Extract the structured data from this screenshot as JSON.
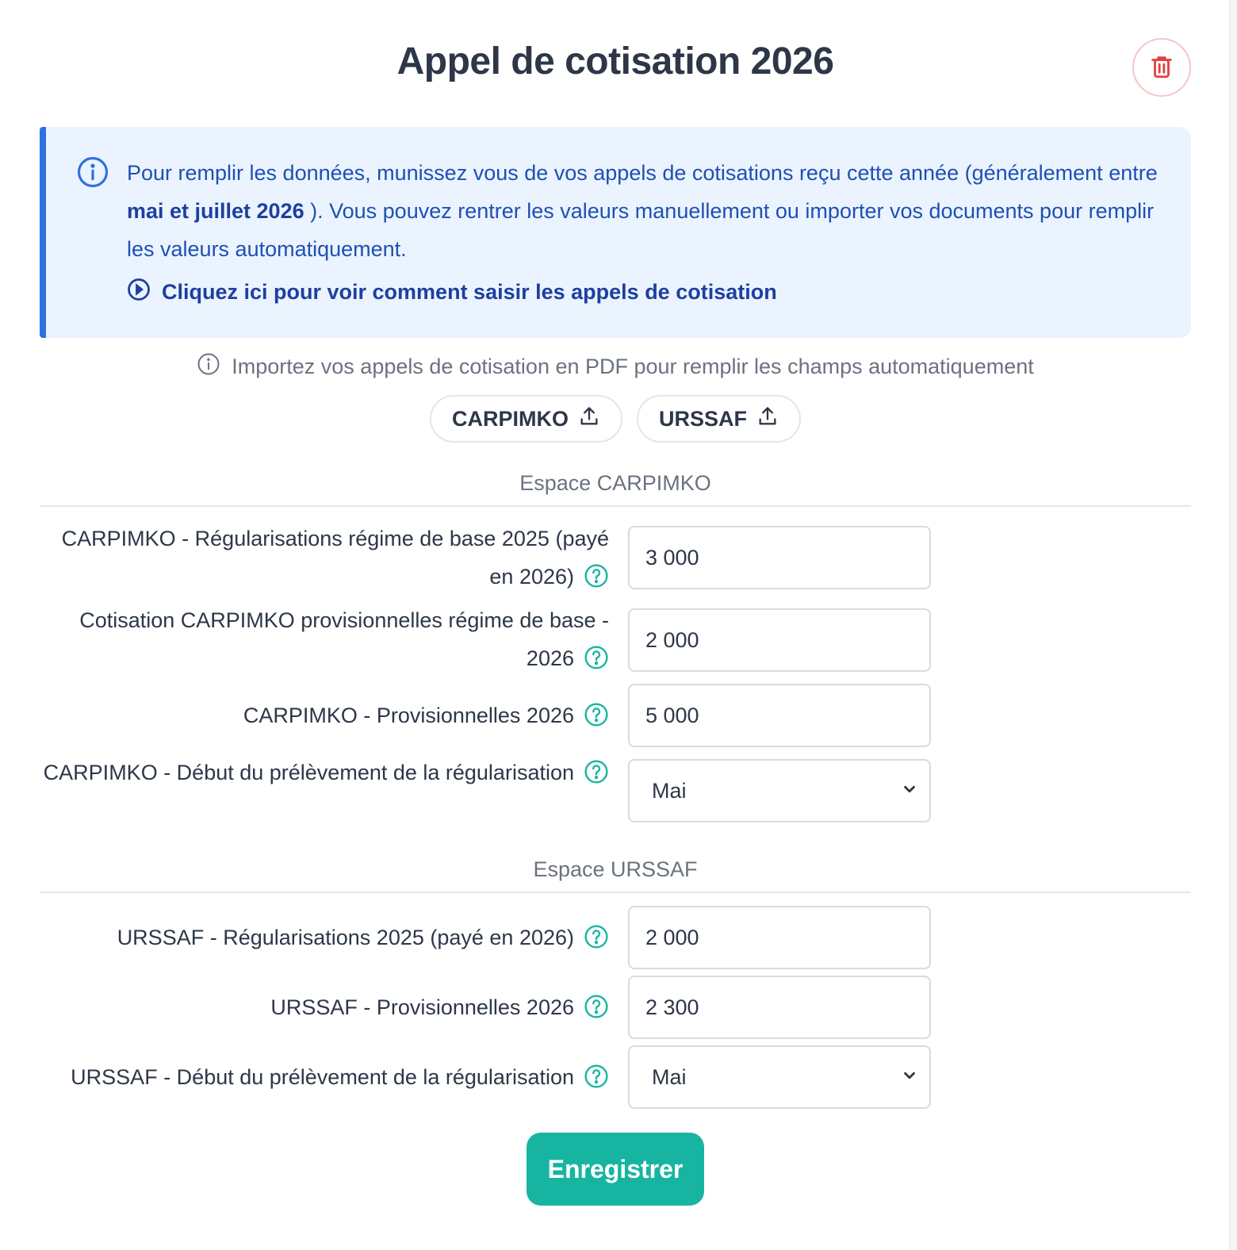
{
  "page": {
    "title": "Appel de cotisation 2026"
  },
  "info": {
    "text_before": "Pour remplir les données, munissez vous de vos appels de cotisations reçu cette année (généralement entre ",
    "text_bold": "mai et juillet 2026",
    "text_after": " ). Vous pouvez rentrer les valeurs manuellement ou importer vos documents pour remplir les valeurs automatiquement.",
    "link_label": "Cliquez ici pour voir comment saisir les appels de cotisation"
  },
  "import": {
    "note": "Importez vos appels de cotisation en PDF pour remplir les champs automatiquement",
    "buttons": [
      "CARPIMKO",
      "URSSAF"
    ]
  },
  "carpimko": {
    "section_title": "Espace CARPIMKO",
    "fields": [
      {
        "label": "CARPIMKO - Régularisations régime de base 2025 (payé en 2026)",
        "value": "3 000"
      },
      {
        "label": "Cotisation CARPIMKO provisionnelles régime de base - 2026",
        "value": "2 000"
      },
      {
        "label": "CARPIMKO - Provisionnelles 2026",
        "value": "5 000"
      },
      {
        "label": "CARPIMKO - Début du prélèvement de la régularisation",
        "value": "Mai"
      }
    ]
  },
  "urssaf": {
    "section_title": "Espace URSSAF",
    "fields": [
      {
        "label": "URSSAF - Régularisations 2025 (payé en 2026)",
        "value": "2 000"
      },
      {
        "label": "URSSAF - Provisionnelles 2026",
        "value": "2 300"
      },
      {
        "label": "URSSAF - Début du prélèvement de la régularisation",
        "value": "Mai"
      }
    ]
  },
  "actions": {
    "save_label": "Enregistrer"
  },
  "colors": {
    "accent": "#17b5a1",
    "info_blue": "#2f6fe4",
    "danger": "#e53e3e"
  }
}
